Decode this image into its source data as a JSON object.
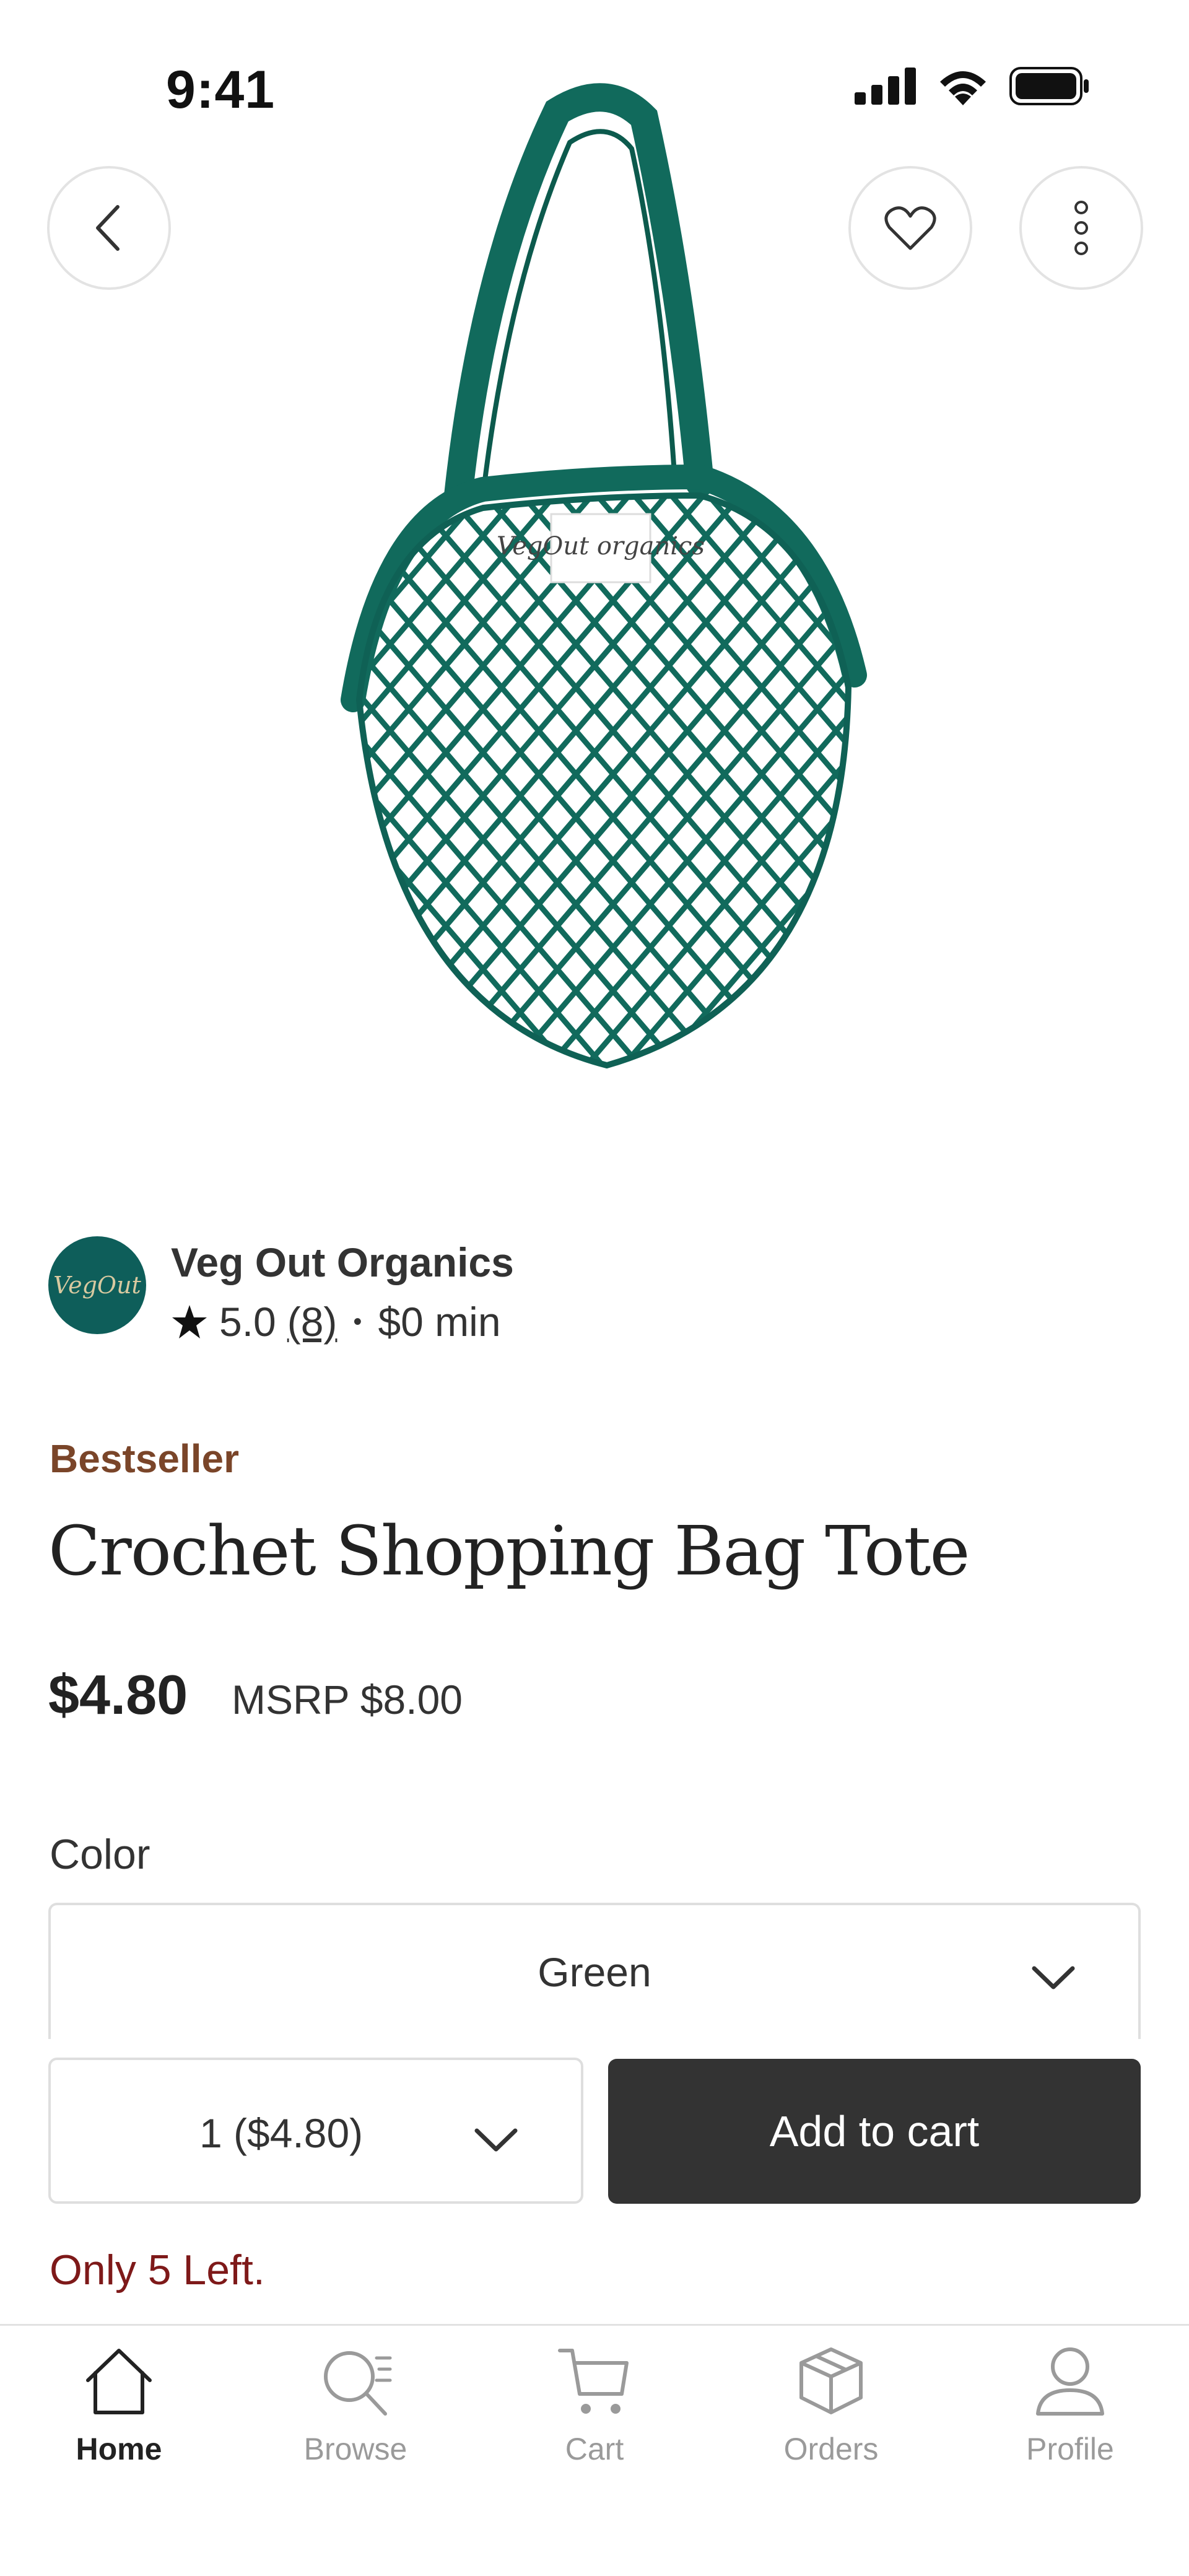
{
  "status_bar": {
    "time": "9:41"
  },
  "product": {
    "image_description": "Green crochet mesh tote bag with Veg Out Organics label",
    "bestseller_label": "Bestseller",
    "title": "Crochet Shopping Bag Tote",
    "price": "$4.80",
    "msrp": "MSRP $8.00",
    "stock_notice": "Only 5 Left.",
    "image_label_text": "VegOut organics"
  },
  "shop": {
    "name": "Veg Out Organics",
    "rating": "5.0",
    "review_count": "(8)",
    "separator": "•",
    "minimum": "$0 min",
    "logo_text": "VegOut"
  },
  "options": {
    "color_label": "Color",
    "color_value": "Green",
    "quantity_value": "1 ($4.80)"
  },
  "actions": {
    "add_to_cart": "Add to cart"
  },
  "nav": {
    "items": [
      {
        "label": "Home",
        "active": true
      },
      {
        "label": "Browse",
        "active": false
      },
      {
        "label": "Cart",
        "active": false
      },
      {
        "label": "Orders",
        "active": false
      },
      {
        "label": "Profile",
        "active": false
      }
    ]
  },
  "colors": {
    "bag_green": "#116a5c",
    "bestseller_brown": "#7a4529",
    "stock_red": "#7e1919",
    "button_dark": "#333333"
  }
}
